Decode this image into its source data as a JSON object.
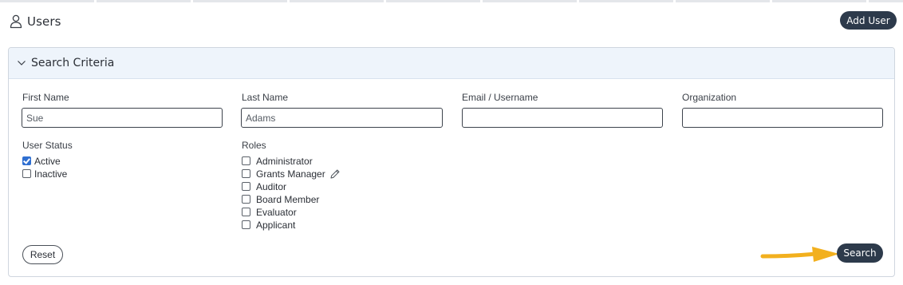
{
  "header": {
    "title": "Users",
    "add_user_label": "Add User"
  },
  "search_panel": {
    "title": "Search Criteria",
    "first_name": {
      "label": "First Name",
      "value": "Sue"
    },
    "last_name": {
      "label": "Last Name",
      "value": "Adams"
    },
    "email": {
      "label": "Email / Username",
      "value": ""
    },
    "organization": {
      "label": "Organization",
      "value": ""
    },
    "user_status": {
      "label": "User Status",
      "options": [
        {
          "label": "Active",
          "checked": true
        },
        {
          "label": "Inactive",
          "checked": false
        }
      ]
    },
    "roles": {
      "label": "Roles",
      "options": [
        {
          "label": "Administrator",
          "checked": false
        },
        {
          "label": "Grants Manager",
          "checked": false
        },
        {
          "label": "Auditor",
          "checked": false
        },
        {
          "label": "Board Member",
          "checked": false
        },
        {
          "label": "Evaluator",
          "checked": false
        },
        {
          "label": "Applicant",
          "checked": false
        }
      ]
    },
    "reset_label": "Reset",
    "search_label": "Search"
  },
  "icons": {
    "header": "user-icon",
    "panel_toggle": "chevron-down-icon",
    "role_edit": "pencil-icon",
    "annotation": "arrow-pointer"
  },
  "colors": {
    "primary_button": "#2d3a4b",
    "panel_header_bg": "#eef4fb",
    "checkbox_accent": "#2f6fd1",
    "annotation_arrow": "#f2b01e"
  }
}
